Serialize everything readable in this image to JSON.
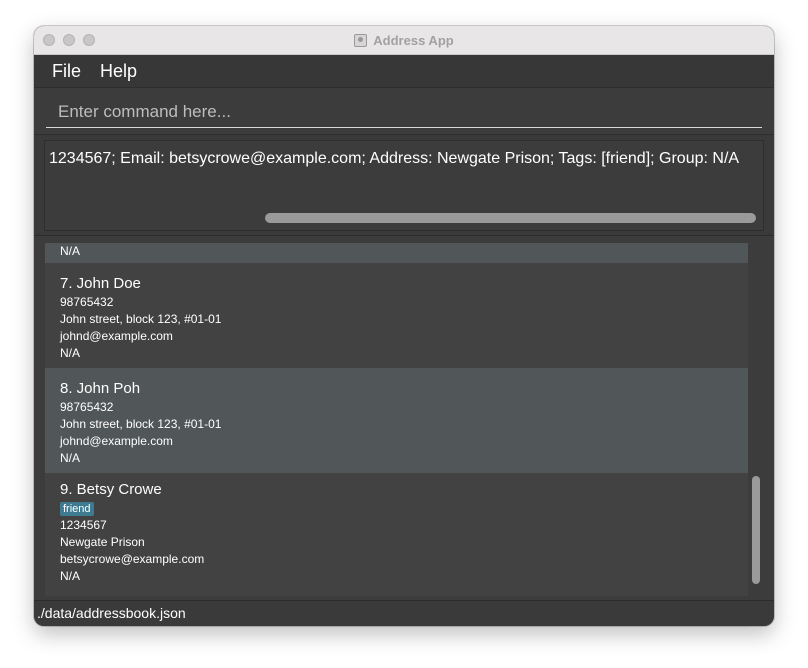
{
  "window": {
    "title": "Address App"
  },
  "menu": {
    "file": "File",
    "help": "Help"
  },
  "command": {
    "placeholder": "Enter command here...",
    "value": ""
  },
  "result": {
    "text": "1234567; Email: betsycrowe@example.com; Address: Newgate Prison; Tags: [friend]; Group: N/A"
  },
  "persons": [
    {
      "partial_line": "N/A"
    },
    {
      "name": "7.  John Doe",
      "phone": "98765432",
      "address": "John street, block 123, #01-01",
      "email": "johnd@example.com",
      "group": "N/A"
    },
    {
      "name": "8.  John Poh",
      "phone": "98765432",
      "address": "John street, block 123, #01-01",
      "email": "johnd@example.com",
      "group": "N/A"
    },
    {
      "name": "9.  Betsy Crowe",
      "tag": "friend",
      "phone": "1234567",
      "address": "Newgate Prison",
      "email": "betsycrowe@example.com",
      "group": "N/A"
    }
  ],
  "status": {
    "path": "./data/addressbook.json"
  },
  "colors": {
    "tag_background": "#3e7b91",
    "card_selected": "#515658",
    "card_default": "#424242"
  }
}
